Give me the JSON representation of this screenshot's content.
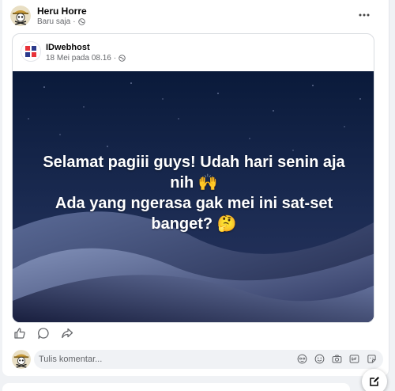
{
  "post": {
    "author": "Heru Horre",
    "time": "Baru saja",
    "separator": "·",
    "shared": {
      "page_name": "IDwebhost",
      "date": "18 Mei pada 08.16",
      "separator": "·",
      "image_text": {
        "line1": "Selamat pagiii guys! Udah hari senin aja",
        "line2": "nih 🙌",
        "line3": "Ada yang ngerasa gak mei ini sat-set",
        "line4": "banget? 🤔"
      }
    },
    "actions": [
      "like-icon",
      "comment-icon",
      "share-icon"
    ]
  },
  "comment": {
    "placeholder": "Tulis komentar...",
    "tools": [
      "avatar-sticker-icon",
      "emoji-icon",
      "camera-icon",
      "gif-icon",
      "sticker-icon"
    ]
  },
  "colors": {
    "meta_text": "#65676b",
    "image_bg": "#0b1530",
    "page_bg": "#f0f2f5"
  }
}
